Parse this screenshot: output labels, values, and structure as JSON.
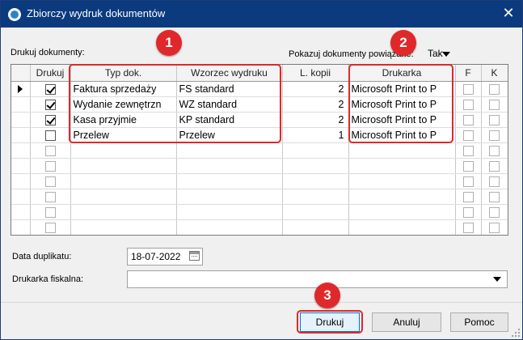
{
  "window": {
    "title": "Zbiorczy wydruk dokumentów"
  },
  "labels": {
    "print_documents": "Drukuj dokumenty:",
    "show_linked": "Pokazuj dokumenty powiązane:",
    "show_linked_value": "Tak",
    "duplicate_date": "Data duplikatu:",
    "fiscal_printer": "Drukarka fiskalna:"
  },
  "grid": {
    "columns": [
      "Drukuj",
      "Typ dok.",
      "Wzorzec wydruku",
      "L. kopii",
      "Drukarka",
      "F",
      "K"
    ],
    "rows": [
      {
        "print": true,
        "type": "Faktura sprzedaży",
        "template": "FS standard",
        "copies": "2",
        "printer": "Microsoft Print to P"
      },
      {
        "print": true,
        "type": "Wydanie zewnętrzn",
        "template": "WZ standard",
        "copies": "2",
        "printer": "Microsoft Print to P"
      },
      {
        "print": true,
        "type": "Kasa przyjmie",
        "template": "KP standard",
        "copies": "2",
        "printer": "Microsoft Print to P"
      },
      {
        "print": false,
        "type": "Przelew",
        "template": "Przelew",
        "copies": "1",
        "printer": "Microsoft Print to P"
      }
    ],
    "empty_rows": 6
  },
  "form": {
    "duplicate_date_value": "18-07-2022",
    "fiscal_printer_value": ""
  },
  "buttons": {
    "print": "Drukuj",
    "cancel": "Anuluj",
    "help": "Pomoc"
  },
  "annotations": [
    "1",
    "2",
    "3"
  ],
  "colors": {
    "titlebar": "#0b3a7e",
    "annotation": "#e0282a",
    "default_button_border": "#0078d7"
  },
  "icons": {
    "window": "app-icon",
    "close": "close-icon",
    "dropdown": "chevron-down-icon",
    "calendar": "calendar-icon"
  }
}
